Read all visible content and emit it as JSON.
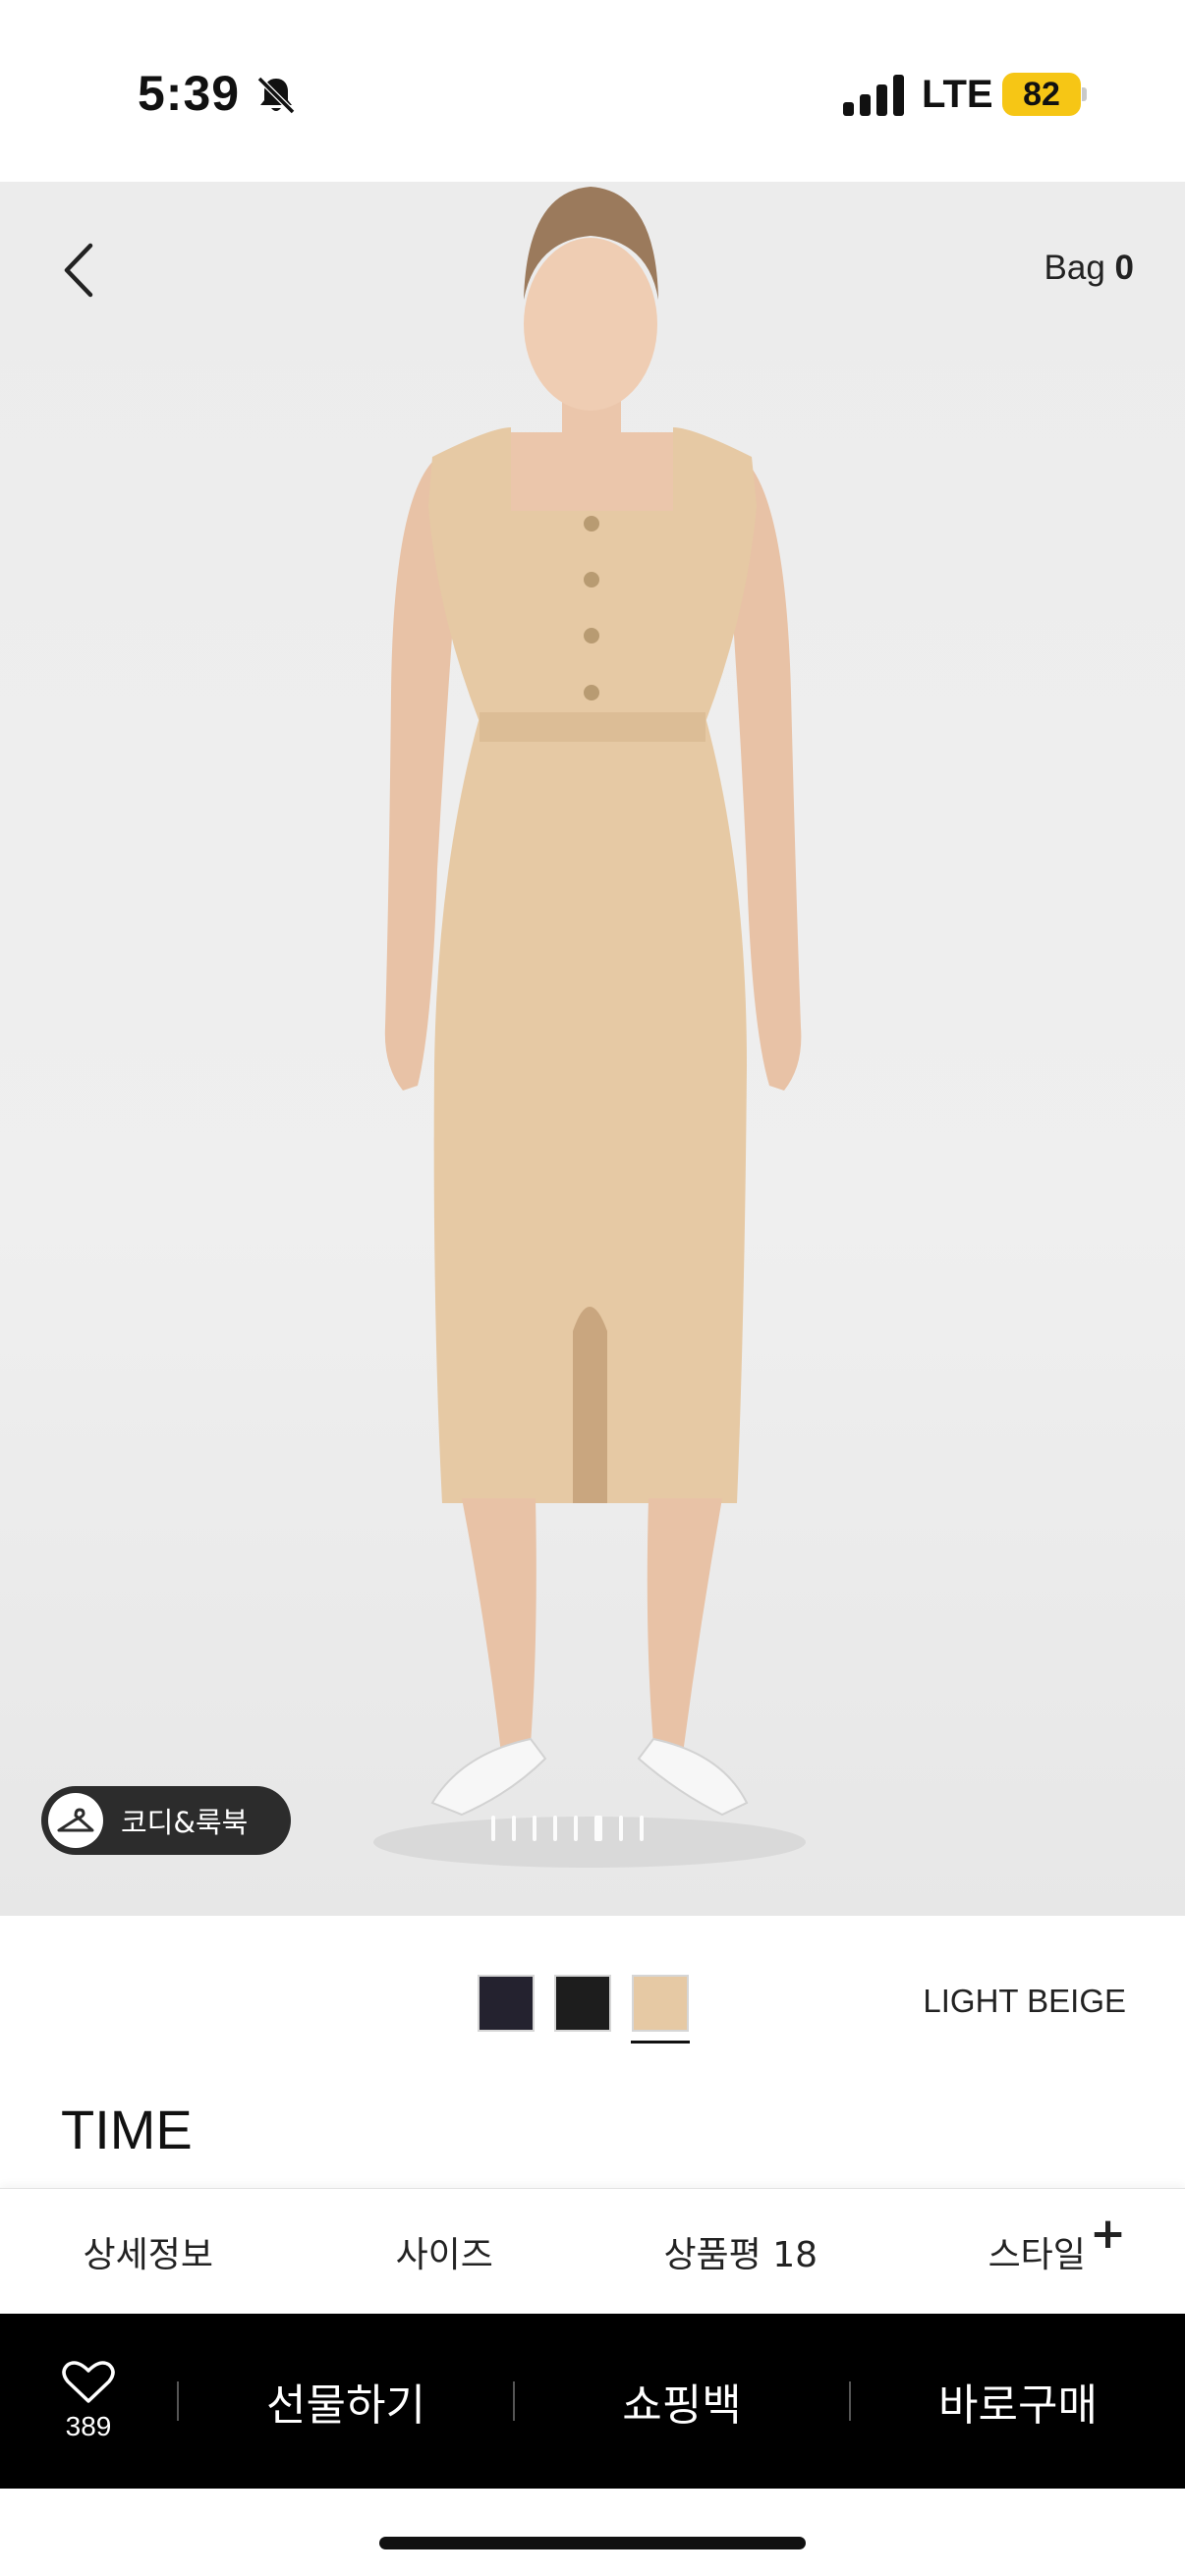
{
  "status_bar": {
    "time": "5:39",
    "network": "LTE",
    "battery": "82"
  },
  "header": {
    "bag_label": "Bag",
    "bag_count": "0"
  },
  "hero": {
    "codi_label": "코디&룩북",
    "image_count": 8,
    "active_image": 6
  },
  "swatches": [
    {
      "name": "navy",
      "color": "#24222f"
    },
    {
      "name": "black",
      "color": "#1d1d1d"
    },
    {
      "name": "light-beige",
      "color": "#e6c9a4",
      "selected": true
    }
  ],
  "selected_color": "LIGHT BEIGE",
  "product": {
    "brand": "TIME"
  },
  "tabs": [
    {
      "label": "상세정보"
    },
    {
      "label": "사이즈"
    },
    {
      "label": "상품평 18"
    },
    {
      "label": "스타일"
    }
  ],
  "tabs_plus": "+",
  "action_bar": {
    "wish_count": "389",
    "gift": "선물하기",
    "cart": "쇼핑백",
    "buy": "바로구매"
  },
  "colors": {
    "battery": "#f6c615",
    "action_bar_bg": "#000000",
    "dress": "#e6c9a4"
  }
}
